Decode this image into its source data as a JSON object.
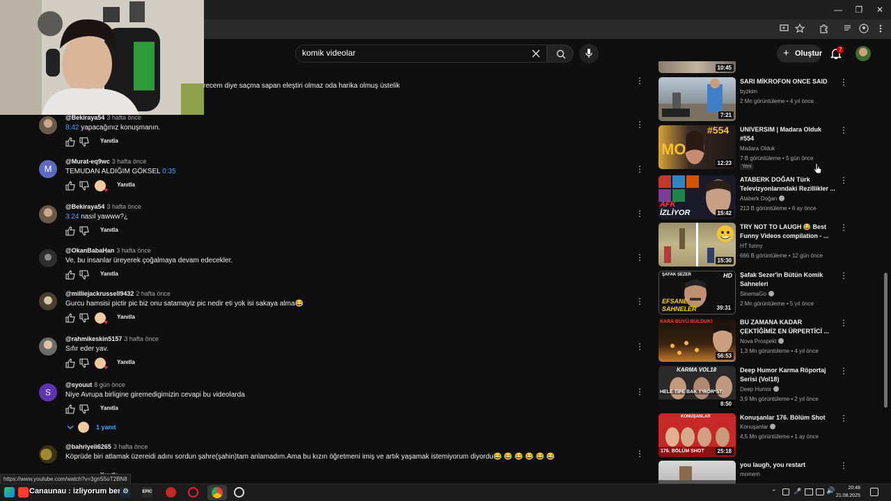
{
  "browser": {
    "window_controls": [
      "—",
      "❐",
      "✕"
    ]
  },
  "header": {
    "search_value": "komik videolar",
    "create_label": "Oluştur",
    "notification_count": "7"
  },
  "partial_comment_text": "recem diye saçma sapan eleştiri olmaz oda harika olmuş üstelik",
  "comments": [
    {
      "author": "@Bekiraya54",
      "time": "3 hafta önce",
      "timestamp": "8:42",
      "text": " yapacağınız konuşmanın.",
      "reply": "Yanıtla",
      "hearted": false
    },
    {
      "author": "@Murat-eq9wc",
      "time": "3 hafta önce",
      "timestamp": "",
      "text": "TEMUDAN ALDIĞIM GÖKSEL ",
      "timestamp_after": "0:35",
      "reply": "Yanıtla",
      "hearted": true,
      "avatar_letter": "M"
    },
    {
      "author": "@Bekiraya54",
      "time": "3 hafta önce",
      "timestamp": "3:24",
      "text": " nasıl yawww?¿",
      "reply": "Yanıtla",
      "hearted": false
    },
    {
      "author": "@OkanBabaHan",
      "time": "3 hafta önce",
      "timestamp": "",
      "text": "Ve, bu insanlar üreyerek çoğalmaya devam edecekler.",
      "reply": "Yanıtla",
      "hearted": false
    },
    {
      "author": "@milliejackrussell9432",
      "time": "2 hafta önce",
      "timestamp": "",
      "text": "Gurcu hamsisi pictir pic biz onu satamayiz pic nedir eti yok isi sakaya alma😂",
      "reply": "Yanıtla",
      "hearted": true
    },
    {
      "author": "@rahmikeskin5157",
      "time": "3 hafta önce",
      "timestamp": "",
      "text": "Sıfır eder yav.",
      "reply": "Yanıtla",
      "hearted": true
    },
    {
      "author": "@syouut",
      "time": "8 gün önce",
      "timestamp": "",
      "text": "Niye Avrupa birligine giremedigimizin cevapi bu videolarda",
      "reply": "Yanıtla",
      "hearted": false,
      "avatar_letter": "S"
    },
    {
      "author": "@bahriyeli6265",
      "time": "3 hafta önce",
      "timestamp": "",
      "text": "Köprüde biri atlamak üzereidi adını sordun şahre(şahin)tam anlamadım.Ama bu kızın öğretmeni imiş ve artık yaşamak istemiyorum diyordu😂 😂 😂 😂 😂 😂",
      "reply": "Yanıtla",
      "hearted": false
    }
  ],
  "replies_toggle": "1 yanıt",
  "videos": [
    {
      "title": "SARI MİKROFON ONCE SAID",
      "channel": "byzkim",
      "verified": false,
      "meta": "2 Mn görüntüleme • 4 yıl önce",
      "duration": "7:21",
      "badge": ""
    },
    {
      "title": "UNIVERSIM | Madara Olduk #554",
      "channel": "Madara Olduk",
      "verified": false,
      "meta": "7 B görüntüleme • 5 gün önce",
      "duration": "12:23",
      "badge": "Yeni"
    },
    {
      "title": "ATABERK DOĞAN Türk Televizyonlarındaki Rezillikler ...",
      "channel": "Ataberk Doğan",
      "verified": true,
      "meta": "213 B görüntüleme • 6 ay önce",
      "duration": "15:42",
      "badge": ""
    },
    {
      "title": "TRY NOT TO LAUGH 😂 Best Funny Videos compilation - ...",
      "channel": "HT funny",
      "verified": false,
      "meta": "666 B görüntüleme • 12 gün önce",
      "duration": "15:30",
      "badge": ""
    },
    {
      "title": "Şafak Sezer'in Bütün Komik Sahneleri",
      "channel": "SinemaGo",
      "verified": true,
      "meta": "2 Mn görüntüleme • 5 yıl önce",
      "duration": "39:31",
      "badge": ""
    },
    {
      "title": "BU ZAMANA KADAR ÇEKTİĞİMİZ EN ÜRPERTİCİ ...",
      "channel": "Nova Prospekt",
      "verified": true,
      "meta": "1,3 Mn görüntüleme • 4 yıl önce",
      "duration": "56:53",
      "badge": ""
    },
    {
      "title": "Deep Humor Karma Röportaj Serisi (Vol18)",
      "channel": "Deep Humor",
      "verified": true,
      "meta": "3,9 Mn görüntüleme • 2 yıl önce",
      "duration": "8:50",
      "badge": ""
    },
    {
      "title": "Konuşanlar 176. Bölüm Shot",
      "channel": "Konuşanlar",
      "verified": true,
      "meta": "4,5 Mn görüntüleme • 1 ay önce",
      "duration": "25:18",
      "badge": ""
    },
    {
      "title": "you laugh, you restart",
      "channel": "momem",
      "verified": false,
      "meta": "",
      "duration": "",
      "badge": ""
    }
  ],
  "top_thumb_duration": "10:45",
  "thumb_texts": {
    "v2": "#554",
    "v2b": "MO",
    "v3": "AFK",
    "v3b": "İZLİYOR",
    "v5a": "EFSANE",
    "v5b": "SAHNELER",
    "v5c": "HD",
    "v5d": "ŞAFAK SEZER",
    "v6": "KARA BÜYÜ BULDUK!",
    "v7a": "KARMA VOL18",
    "v7b": "HELE TİPE BAK T*RÖR*ST",
    "v8a": "KONUŞANLAR",
    "v8b": "176. BÖLÜM SHOT"
  },
  "status_url": "https://www.youtube.com/watch?v=3gnS5oT2BN8",
  "taskbar": {
    "overlay_text": "Canaunau : izliyorum ben",
    "time": "20:48",
    "date": "21.08.2025",
    "epic": "EPIC"
  }
}
